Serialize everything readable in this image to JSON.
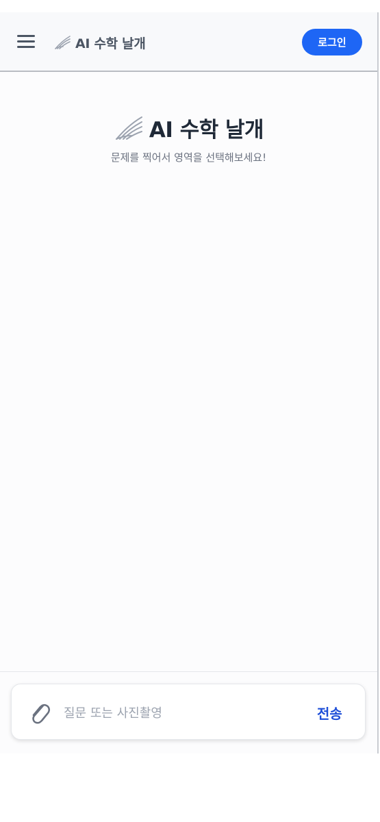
{
  "header": {
    "brand_icon": "wing-icon",
    "brand_title": "AI 수학 날개",
    "menu_icon": "hamburger-menu-icon",
    "login_label": "로그인"
  },
  "hero": {
    "icon": "wing-icon",
    "title": "AI 수학 날개",
    "subtitle": "문제를 찍어서 영역을 선택해보세요!"
  },
  "composer": {
    "attach_icon": "paperclip-icon",
    "placeholder": "질문 또는 사진촬영",
    "value": "",
    "send_label": "전송"
  },
  "colors": {
    "accent": "#1e66f5",
    "send_text": "#1d4ed8",
    "title_text": "#1f2937",
    "muted_text": "#6b7280"
  }
}
